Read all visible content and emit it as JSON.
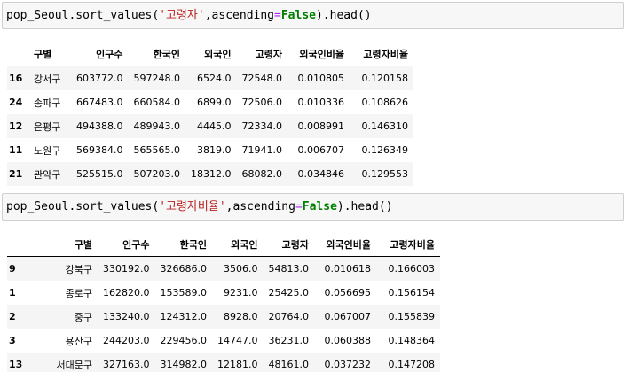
{
  "cell1": {
    "code_prefix": "pop_Seoul.sort_values(",
    "code_string": "'고령자'",
    "code_comma": ",ascending",
    "code_eq": "=",
    "code_kw": "False",
    "code_suffix": ").head()"
  },
  "cell2": {
    "code_prefix": "pop_Seoul.sort_values(",
    "code_string": "'고령자비율'",
    "code_comma": ",ascending",
    "code_eq": "=",
    "code_kw": "False",
    "code_suffix": ").head()"
  },
  "table1": {
    "headers": [
      "",
      "구별",
      "인구수",
      "한국인",
      "외국인",
      "고령자",
      "외국인비율",
      "고령자비율"
    ],
    "rows": [
      [
        "16",
        "강서구",
        "603772.0",
        "597248.0",
        "6524.0",
        "72548.0",
        "0.010805",
        "0.120158"
      ],
      [
        "24",
        "송파구",
        "667483.0",
        "660584.0",
        "6899.0",
        "72506.0",
        "0.010336",
        "0.108626"
      ],
      [
        "12",
        "은평구",
        "494388.0",
        "489943.0",
        "4445.0",
        "72334.0",
        "0.008991",
        "0.146310"
      ],
      [
        "11",
        "노원구",
        "569384.0",
        "565565.0",
        "3819.0",
        "71941.0",
        "0.006707",
        "0.126349"
      ],
      [
        "21",
        "관악구",
        "525515.0",
        "507203.0",
        "18312.0",
        "68082.0",
        "0.034846",
        "0.129553"
      ]
    ]
  },
  "table2": {
    "headers": [
      "",
      "구별",
      "인구수",
      "한국인",
      "외국인",
      "고령자",
      "외국인비율",
      "고령자비율"
    ],
    "rows": [
      [
        "9",
        "강북구",
        "330192.0",
        "326686.0",
        "3506.0",
        "54813.0",
        "0.010618",
        "0.166003"
      ],
      [
        "1",
        "종로구",
        "162820.0",
        "153589.0",
        "9231.0",
        "25425.0",
        "0.056695",
        "0.156154"
      ],
      [
        "2",
        "중구",
        "133240.0",
        "124312.0",
        "8928.0",
        "20764.0",
        "0.067007",
        "0.155839"
      ],
      [
        "3",
        "용산구",
        "244203.0",
        "229456.0",
        "14747.0",
        "36231.0",
        "0.060388",
        "0.148364"
      ],
      [
        "13",
        "서대문구",
        "327163.0",
        "314982.0",
        "12181.0",
        "48161.0",
        "0.037232",
        "0.147208"
      ]
    ]
  }
}
